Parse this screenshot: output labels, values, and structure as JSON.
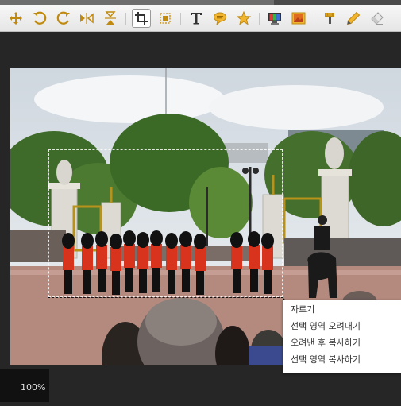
{
  "toolbar": {
    "tools": [
      {
        "name": "move-icon",
        "tooltip": ""
      },
      {
        "name": "rotate-left-icon",
        "tooltip": ""
      },
      {
        "name": "rotate-right-icon",
        "tooltip": ""
      },
      {
        "name": "flip-horizontal-icon",
        "tooltip": ""
      },
      {
        "name": "flip-vertical-icon",
        "tooltip": ""
      },
      {
        "name": "crop-icon",
        "tooltip": "",
        "active": true
      },
      {
        "name": "resize-icon",
        "tooltip": ""
      },
      {
        "name": "text-icon",
        "tooltip": ""
      },
      {
        "name": "speech-bubble-icon",
        "tooltip": ""
      },
      {
        "name": "star-icon",
        "tooltip": ""
      },
      {
        "name": "monitor-color-icon",
        "tooltip": ""
      },
      {
        "name": "image-icon",
        "tooltip": ""
      },
      {
        "name": "brush-icon",
        "tooltip": ""
      },
      {
        "name": "pencil-icon",
        "tooltip": ""
      },
      {
        "name": "eraser-icon",
        "tooltip": ""
      }
    ]
  },
  "context_menu": {
    "items": [
      {
        "label": "자르기"
      },
      {
        "label": "선택 영역 오려내기"
      },
      {
        "label": "오려낸 후 복사하기"
      },
      {
        "label": "선택 영역 복사하기"
      }
    ]
  },
  "status": {
    "zoom": "100%"
  },
  "colors": {
    "toolbar_icon": "#c08a10",
    "text_icon": "#333333"
  }
}
